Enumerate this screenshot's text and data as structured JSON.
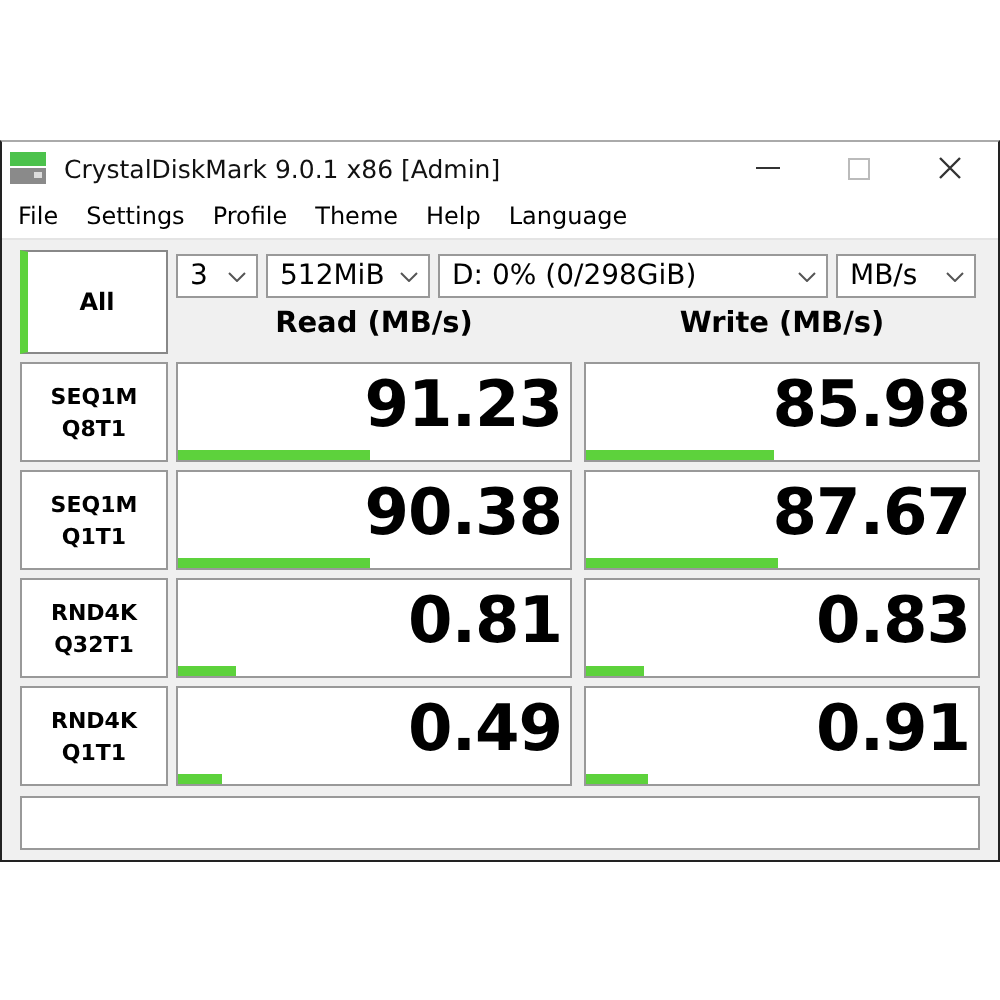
{
  "window": {
    "title": "CrystalDiskMark 9.0.1 x86 [Admin]"
  },
  "menu": [
    "File",
    "Settings",
    "Profile",
    "Theme",
    "Help",
    "Language"
  ],
  "all_button": "All",
  "selectors": [
    {
      "value": "3"
    },
    {
      "value": "512MiB"
    },
    {
      "value": "D: 0% (0/298GiB)"
    },
    {
      "value": "MB/s"
    }
  ],
  "headers": [
    "Read (MB/s)",
    "Write (MB/s)"
  ],
  "rows": [
    {
      "test": [
        "SEQ1M",
        "Q8T1"
      ],
      "read": {
        "value": "91.23",
        "level": 0.49
      },
      "write": {
        "value": "85.98",
        "level": 0.48
      }
    },
    {
      "test": [
        "SEQ1M",
        "Q1T1"
      ],
      "read": {
        "value": "90.38",
        "level": 0.49
      },
      "write": {
        "value": "87.67",
        "level": 0.49
      }
    },
    {
      "test": [
        "RND4K",
        "Q32T1"
      ],
      "read": {
        "value": "0.81",
        "level": 0.15
      },
      "write": {
        "value": "0.83",
        "level": 0.15
      }
    },
    {
      "test": [
        "RND4K",
        "Q1T1"
      ],
      "read": {
        "value": "0.49",
        "level": 0.11
      },
      "write": {
        "value": "0.91",
        "level": 0.16
      }
    }
  ]
}
